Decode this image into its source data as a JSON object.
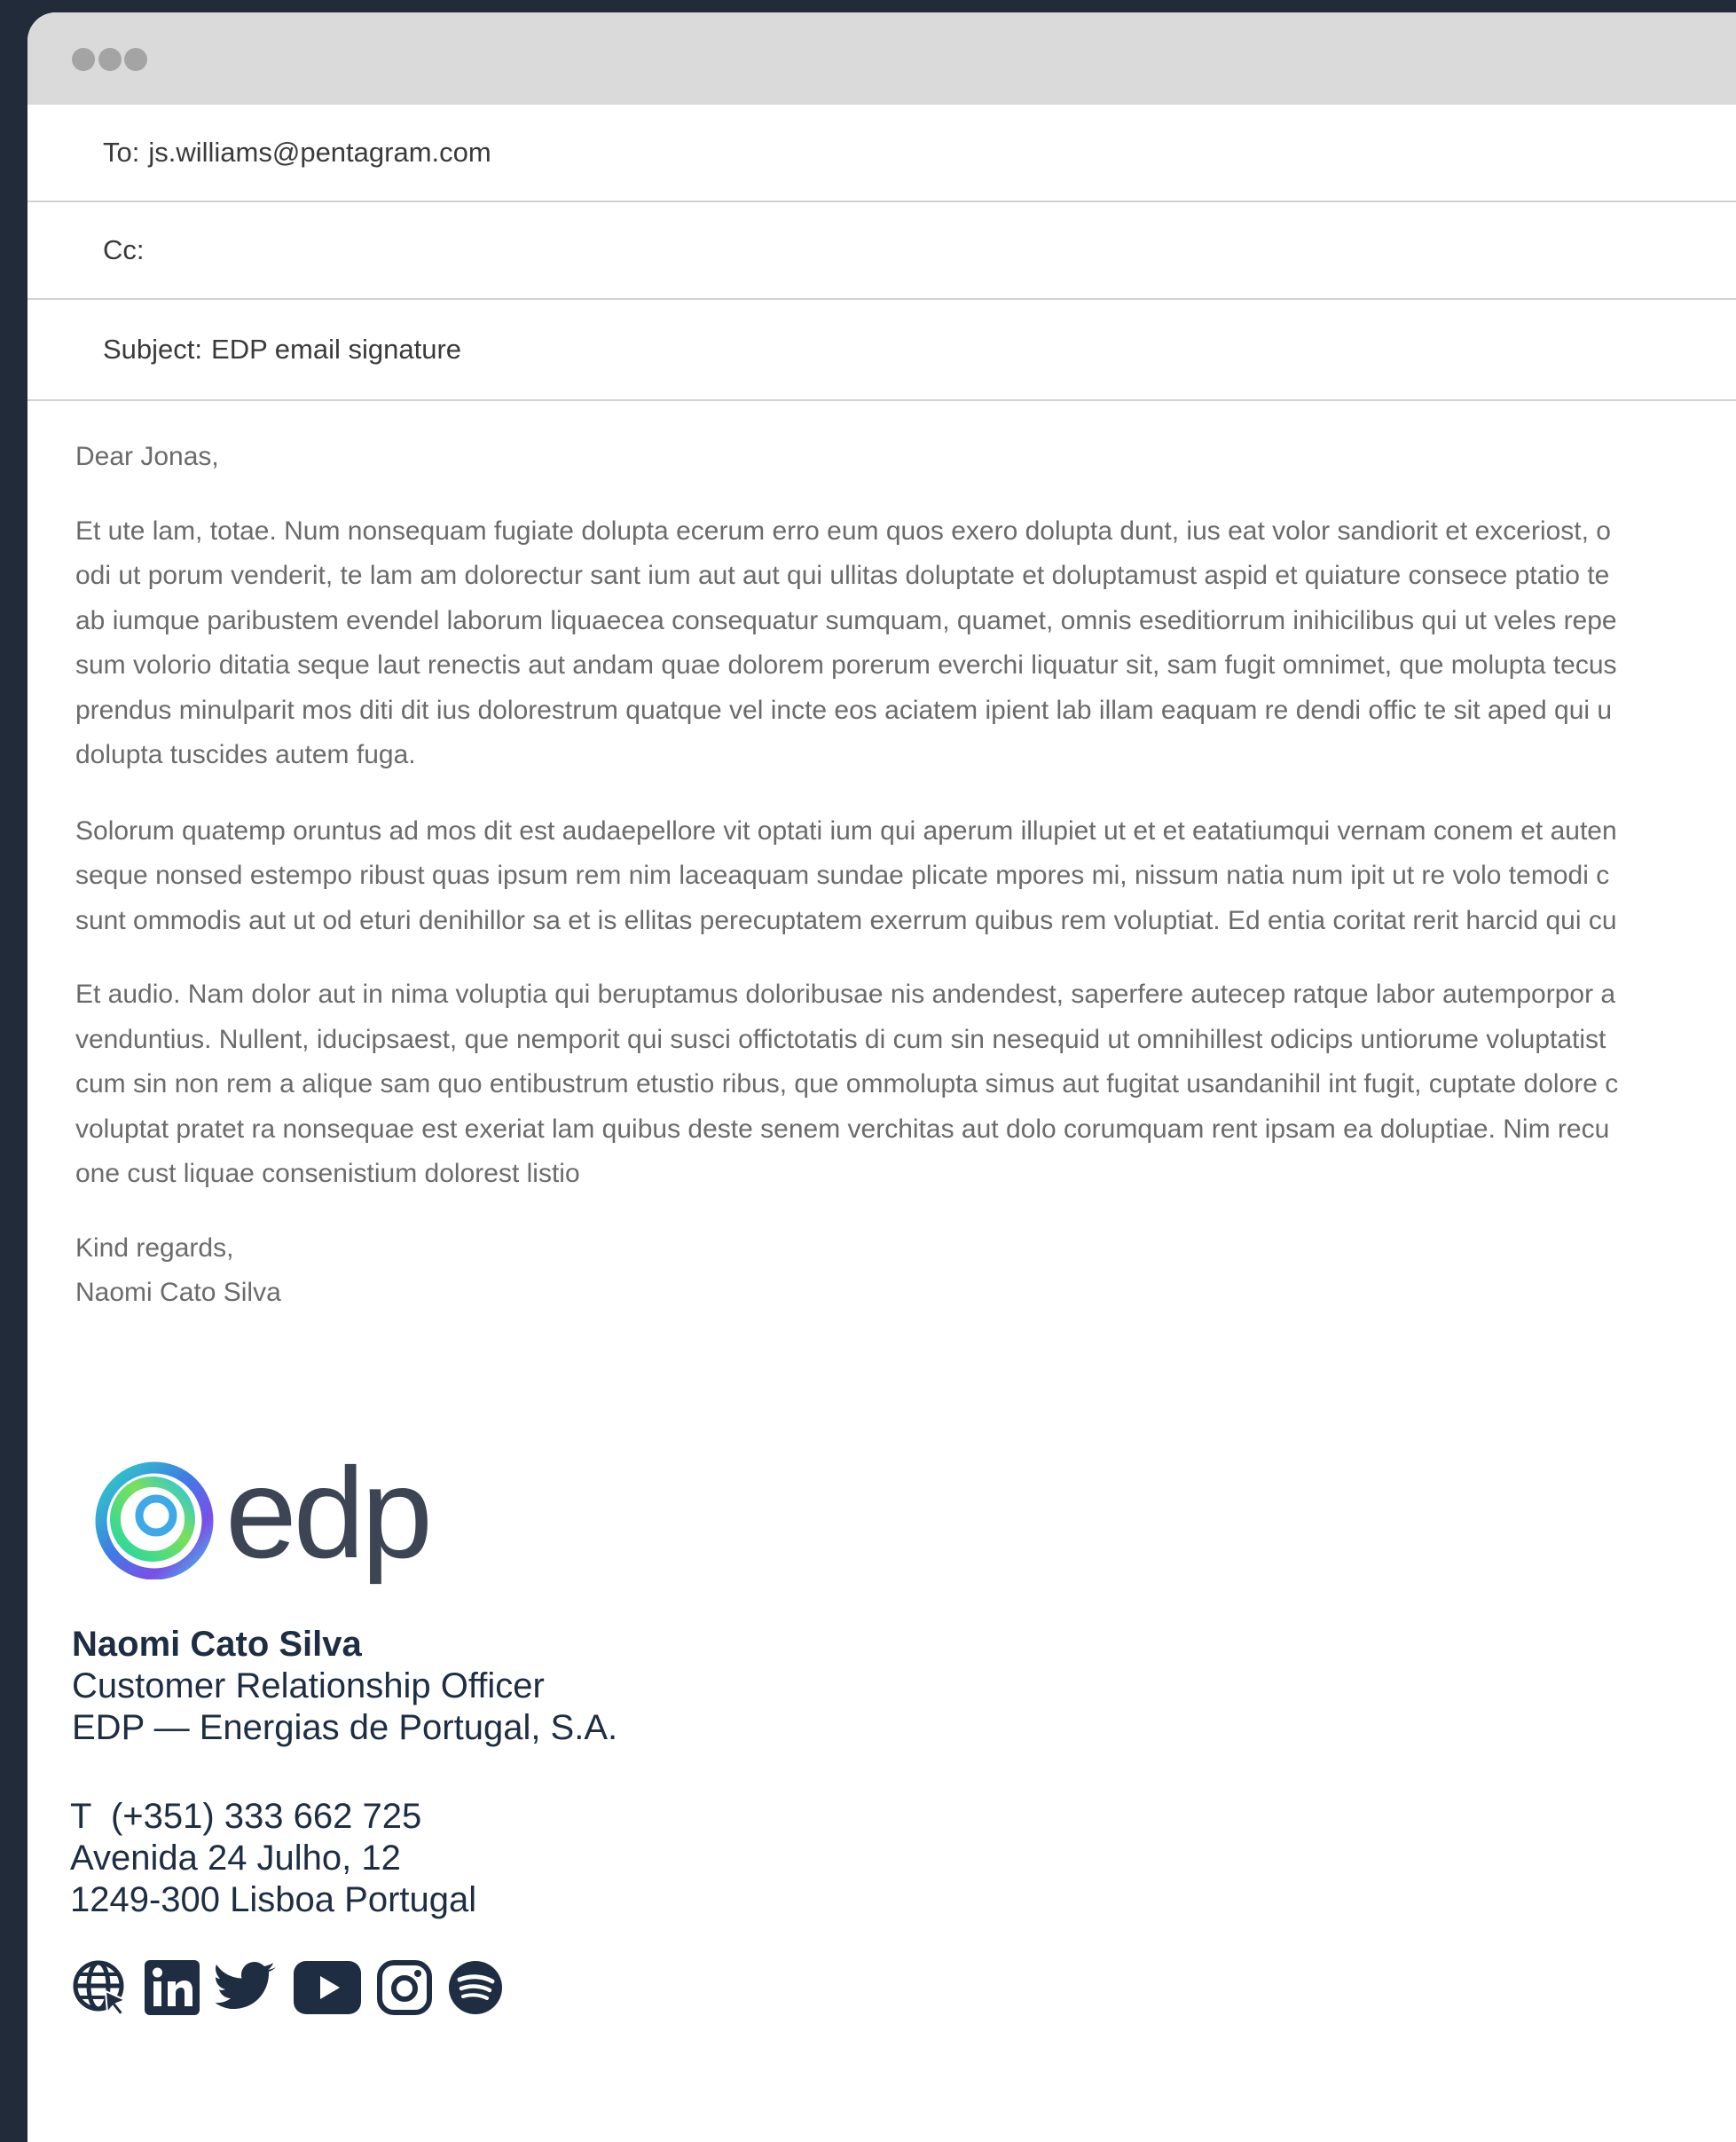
{
  "email": {
    "to_label": "To:",
    "to_value": "js.williams@pentagram.com",
    "cc_label": "Cc:",
    "cc_value": "",
    "subject_label": "Subject:",
    "subject_value": "EDP email signature"
  },
  "body": {
    "greeting": "Dear Jonas,",
    "p1": [
      "Et ute lam, totae. Num nonsequam fugiate dolupta ecerum erro eum quos exero dolupta dunt, ius eat volor sandiorit et exceriost, o",
      "odi ut porum venderit, te lam am dolorectur sant ium aut aut qui ullitas doluptate et doluptamust aspid et quiature consece ptatio te",
      "ab iumque paribustem evendel laborum liquaecea consequatur sumquam, quamet, omnis eseditiorrum inihicilibus qui ut veles repe",
      "sum volorio ditatia seque laut renectis aut andam quae dolorem porerum everchi liquatur sit, sam fugit omnimet, que molupta tecus",
      "prendus minulparit mos diti dit ius dolorestrum quatque vel incte eos aciatem ipient lab illam eaquam re dendi offic te sit aped qui u",
      "dolupta tuscides autem fuga."
    ],
    "p2": [
      "Solorum quatemp oruntus ad mos dit est audaepellore vit optati ium qui aperum illupiet ut et et eatatiumqui vernam conem et auten",
      "seque nonsed estempo ribust quas ipsum rem nim laceaquam sundae plicate mpores mi, nissum natia num ipit ut re volo temodi c",
      "sunt ommodis aut ut od eturi denihillor sa et is ellitas perecuptatem exerrum quibus rem voluptiat. Ed entia coritat rerit harcid qui cu"
    ],
    "p3": [
      "Et audio. Nam dolor aut in nima voluptia qui beruptamus doloribusae nis andendest, saperfere autecep ratque labor autemporpor a",
      "venduntius. Nullent, iducipsaest, que nemporit qui susci offictotatis di cum sin nesequid ut omnihillest odicips untiorume voluptatist",
      "cum sin non rem a alique sam quo entibustrum etustio ribus, que ommolupta simus aut fugitat usandanihil int fugit, cuptate dolore c",
      "voluptat pratet ra nonsequae est exeriat lam quibus deste senem verchitas aut dolo corumquam rent ipsam ea doluptiae. Nim recu",
      "one cust liquae consenistium dolorest listio"
    ],
    "closing": "Kind regards,",
    "closing_name": "Naomi Cato Silva"
  },
  "signature": {
    "logo_text": "edp",
    "name": "Naomi Cato Silva",
    "title": "Customer Relationship Officer",
    "company": "EDP — Energias de Portugal, S.A.",
    "phone": "T  (+351) 333 662 725",
    "address1": "Avenida 24 Julho, 12",
    "address2": "1249-300 Lisboa Portugal",
    "brand_color": "#1f2d43",
    "social_icons": [
      "globe-icon",
      "linkedin-icon",
      "twitter-icon",
      "youtube-icon",
      "instagram-icon",
      "spotify-icon"
    ]
  },
  "colors": {
    "background": "#212b3a",
    "titlebar": "#dadada",
    "window_dots": "#a4a4a4",
    "body_text": "#6b6b6b"
  }
}
